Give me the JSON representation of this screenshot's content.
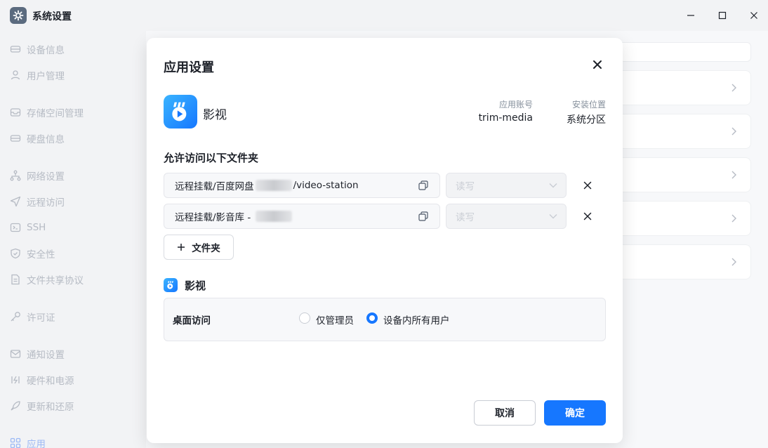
{
  "window": {
    "title": "系统设置"
  },
  "sidebar": {
    "items": [
      {
        "label": "设备信息",
        "icon": "device-icon"
      },
      {
        "label": "用户管理",
        "icon": "user-icon"
      },
      {
        "label": "存储空间管理",
        "icon": "storage-icon"
      },
      {
        "label": "硬盘信息",
        "icon": "disk-icon"
      },
      {
        "label": "网络设置",
        "icon": "network-icon"
      },
      {
        "label": "远程访问",
        "icon": "send-icon"
      },
      {
        "label": "SSH",
        "icon": "terminal-icon"
      },
      {
        "label": "安全性",
        "icon": "shield-icon"
      },
      {
        "label": "文件共享协议",
        "icon": "file-icon"
      },
      {
        "label": "许可证",
        "icon": "key-icon"
      },
      {
        "label": "通知设置",
        "icon": "mail-icon"
      },
      {
        "label": "硬件和电源",
        "icon": "power-icon"
      },
      {
        "label": "更新和还原",
        "icon": "rocket-icon"
      },
      {
        "label": "应用",
        "icon": "apps-grid-icon"
      }
    ]
  },
  "modal": {
    "title": "应用设置",
    "app": {
      "name": "影视",
      "account_label": "应用账号",
      "account_value": "trim-media",
      "location_label": "安装位置",
      "location_value": "系统分区"
    },
    "folders_title": "允许访问以下文件夹",
    "folders": [
      {
        "path_prefix": "远程挂载/百度网盘",
        "path_suffix": "/video-station",
        "permission": "读写"
      },
      {
        "path_prefix": "远程挂载/影音库 - ",
        "path_suffix": "",
        "permission": "读写"
      }
    ],
    "add_folder_label": "文件夹",
    "sub_app_title": "影视",
    "desktop_access": {
      "label": "桌面访问",
      "options": [
        "仅管理员",
        "设备内所有用户"
      ],
      "selected": "设备内所有用户"
    },
    "cancel_label": "取消",
    "confirm_label": "确定"
  },
  "colors": {
    "accent": "#1677ff",
    "sidebar_text": "#b6bbc4"
  }
}
